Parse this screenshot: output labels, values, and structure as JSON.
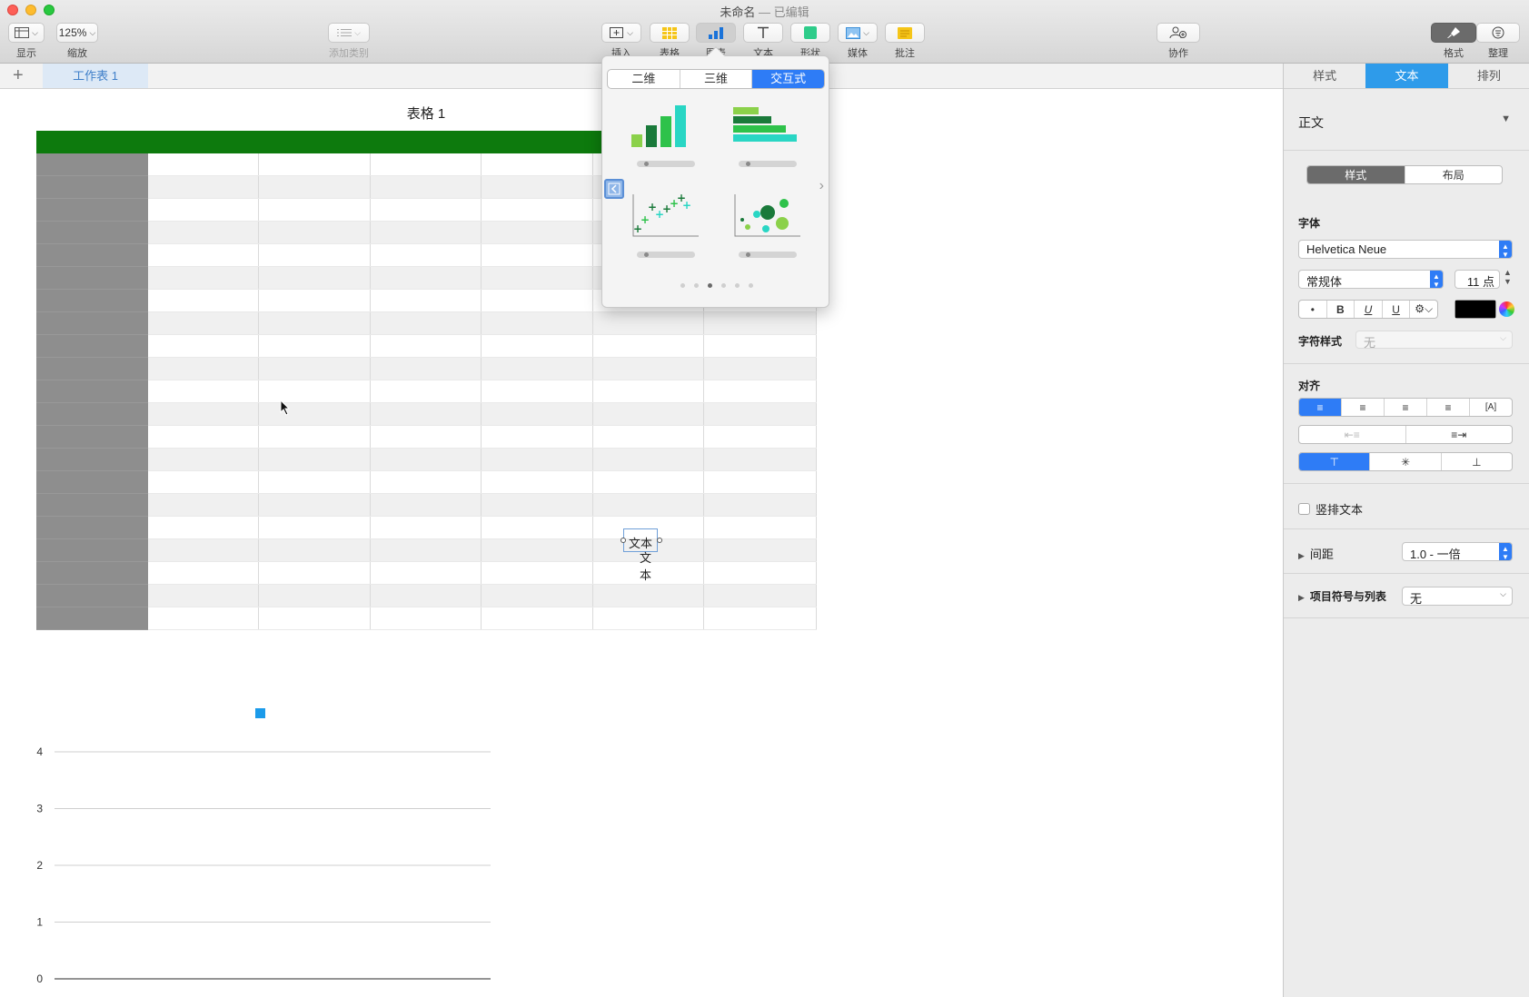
{
  "window": {
    "title": "未命名",
    "subtitle": "— 已编辑"
  },
  "toolbar": {
    "view_label": "显示",
    "zoom_value": "125%",
    "zoom_label": "缩放",
    "category_label": "添加类别",
    "insert_label": "插入",
    "table_label": "表格",
    "chart_label": "图表",
    "text_label": "文本",
    "shape_label": "形状",
    "media_label": "媒体",
    "comment_label": "批注",
    "collab_label": "协作",
    "format_label": "格式",
    "organize_label": "整理"
  },
  "sheet_tab": {
    "add": "+",
    "name": "工作表 1"
  },
  "table": {
    "title": "表格 1",
    "body_rows": 21,
    "columns": 7
  },
  "textbox": {
    "text1": "文本",
    "text2": "文本"
  },
  "chart_popover": {
    "segments": [
      "二维",
      "三维",
      "交互式"
    ],
    "active_segment": 2,
    "thumbnails": [
      "column-chart",
      "bar-chart",
      "scatter-chart",
      "bubble-chart"
    ],
    "page_count": 6,
    "current_page": 2
  },
  "chart_data": {
    "type": "bar",
    "categories": [],
    "values": [],
    "ylim": [
      0,
      4
    ],
    "yticks": [
      "0",
      "1",
      "2",
      "3",
      "4"
    ],
    "legend_color": "#1b9bea",
    "grid": true
  },
  "inspector": {
    "tabs": [
      "样式",
      "文本",
      "排列"
    ],
    "active_tab": 1,
    "paragraph_style": "正文",
    "sub_tabs": [
      "样式",
      "布局"
    ],
    "font_section": "字体",
    "font_name": "Helvetica Neue",
    "font_style": "常规体",
    "font_size": "11 点",
    "char_style_label": "字符样式",
    "char_style_value": "无",
    "align_section": "对齐",
    "vertical_text": "竖排文本",
    "spacing_label": "间距",
    "spacing_value": "1.0 - 一倍",
    "bullets_label": "项目符号与列表",
    "bullets_value": "无",
    "text_color": "#000000"
  },
  "colors": {
    "accent": "#2e7cf6",
    "header_green": "#0d7a0d",
    "selected_tab": "#2e9bea"
  }
}
